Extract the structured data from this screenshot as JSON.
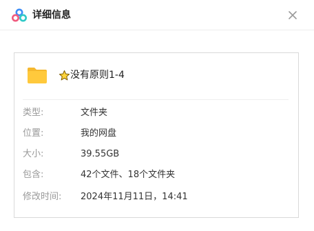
{
  "header": {
    "title": "详细信息",
    "logo_icon": "baidu-netdisk-logo-icon",
    "close_icon": "close-icon"
  },
  "file": {
    "icon": "folder-icon",
    "star_icon": "star-icon",
    "name": "没有原则1-4"
  },
  "details": [
    {
      "label": "类型:",
      "value": "文件夹"
    },
    {
      "label": "位置:",
      "value": "我的网盘"
    },
    {
      "label": "大小:",
      "value": "39.55GB"
    },
    {
      "label": "包含:",
      "value": "42个文件、18个文件夹"
    },
    {
      "label": "修改时间:",
      "value": "2024年11月11日，14:41"
    }
  ],
  "colors": {
    "folder": "#FFC93C",
    "logo_blue": "#3E8EF7",
    "logo_pink": "#F05A7E",
    "logo_cyan": "#2FC9C7"
  }
}
